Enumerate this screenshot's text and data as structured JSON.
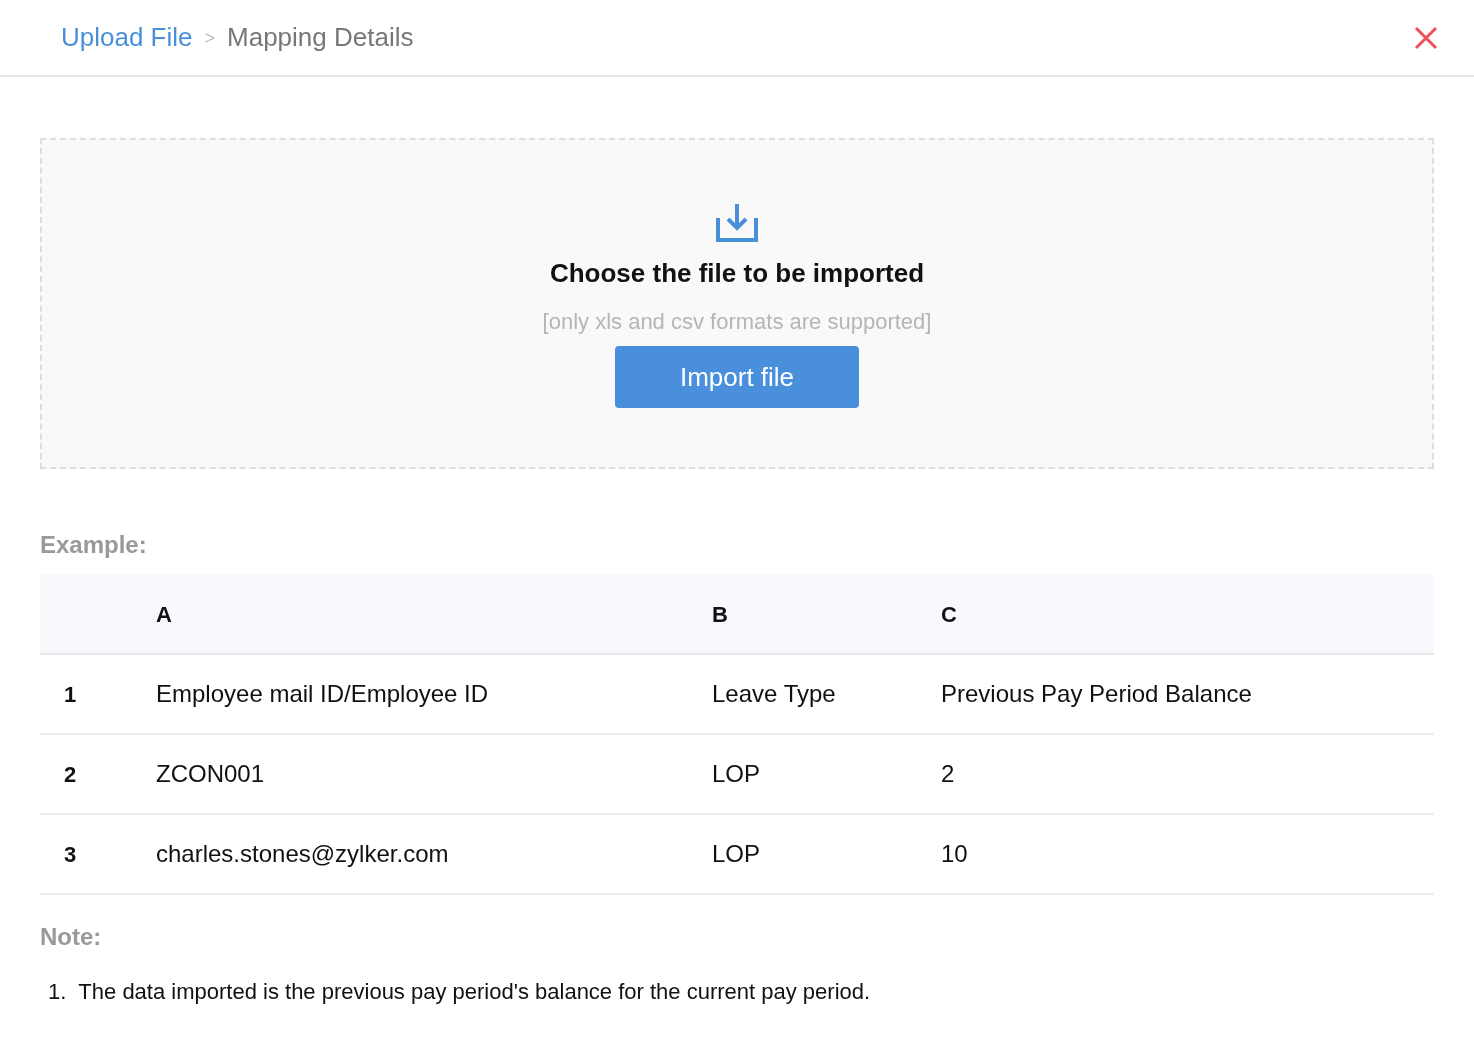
{
  "breadcrumb": {
    "steps": [
      {
        "label": "Upload File",
        "selected": true
      },
      {
        "label": "Mapping Details",
        "selected": false
      }
    ],
    "separator": ">"
  },
  "upload": {
    "title": "Choose the file to be imported",
    "hint": "[only xls and csv formats are supported]",
    "button": "Import file"
  },
  "example": {
    "heading": "Example:",
    "columns": [
      "A",
      "B",
      "C"
    ],
    "rows": [
      {
        "number": "1",
        "cells": [
          "Employee mail ID/Employee ID",
          "Leave Type",
          "Previous Pay Period Balance"
        ]
      },
      {
        "number": "2",
        "cells": [
          "ZCON001",
          "LOP",
          "2"
        ]
      },
      {
        "number": "3",
        "cells": [
          "charles.stones@zylker.com",
          "LOP",
          "10"
        ]
      }
    ]
  },
  "note": {
    "heading": "Note:",
    "items": [
      {
        "marker": "1.",
        "text": "The data imported is the previous pay period's balance for the current pay period."
      }
    ]
  }
}
